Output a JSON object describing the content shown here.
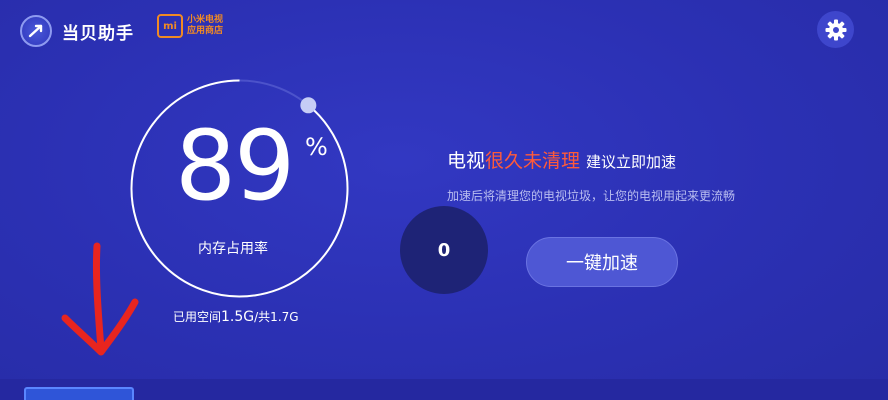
{
  "header": {
    "app_name": "当贝助手",
    "store_logo_text": "mi",
    "store_line1": "小米电视",
    "store_line2": "应用商店"
  },
  "memory": {
    "percent": "89",
    "percent_sign": "%",
    "label": "内存占用率",
    "used_prefix": "已用空间",
    "used_value": "1.5G",
    "total_value": "/共1.7G",
    "usage_fraction": 0.89
  },
  "panel": {
    "headline_part1": "电视",
    "headline_part2": "很久未清理",
    "headline_part3": "建议立即加速",
    "subline": "加速后将清理您的电视垃圾，让您的电视用起来更流畅",
    "counter_value": "0",
    "boost_button": "一键加速"
  },
  "colors": {
    "background": "#2c31b4",
    "highlight": "#ff5a3a",
    "accent_orange": "#f08a24",
    "annotation_red": "#e8251f"
  },
  "icons": {
    "logo": "rocket-logo-icon",
    "settings": "gear-icon",
    "arrow": "red-annotation-arrow"
  }
}
